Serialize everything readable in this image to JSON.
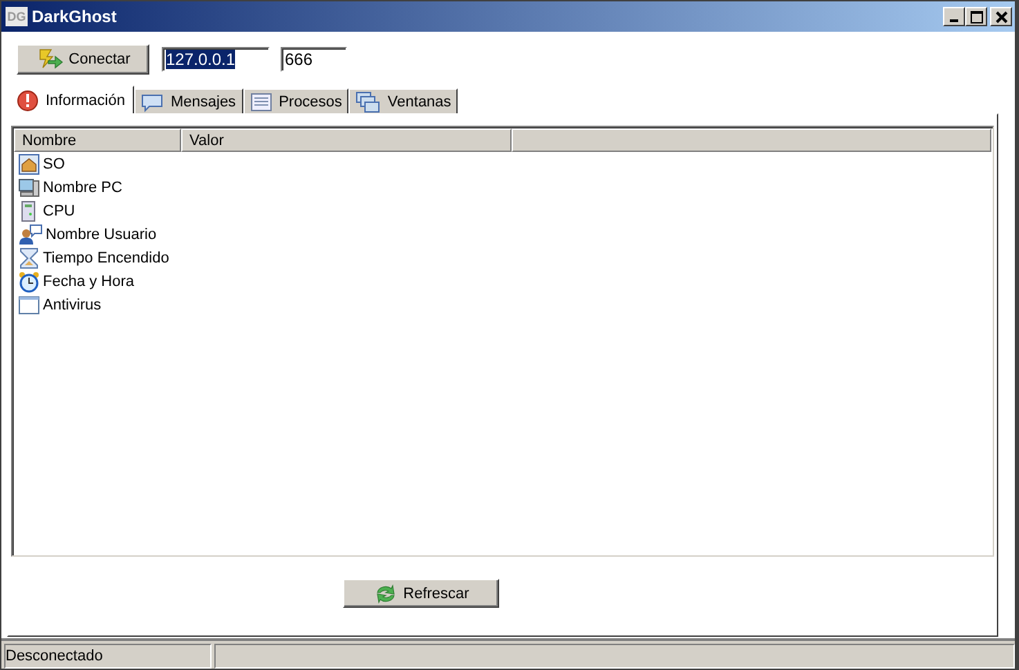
{
  "window": {
    "title": "DarkGhost",
    "icon_text": "DG"
  },
  "toolbar": {
    "connect_button": "Conectar",
    "host": "127.0.0.1",
    "host_selected": true,
    "port": "666"
  },
  "tabs": [
    {
      "label": "Información",
      "kind": "info",
      "selected": true
    },
    {
      "label": "Mensajes",
      "kind": "message",
      "selected": false
    },
    {
      "label": "Procesos",
      "kind": "list",
      "selected": false
    },
    {
      "label": "Ventanas",
      "kind": "windows",
      "selected": false
    }
  ],
  "table": {
    "columns": [
      "Nombre",
      "Valor"
    ],
    "rows": [
      {
        "name": "SO",
        "kind": "home"
      },
      {
        "name": "Nombre PC",
        "kind": "computer"
      },
      {
        "name": "CPU",
        "kind": "tower"
      },
      {
        "name": "Nombre Usuario",
        "kind": "user"
      },
      {
        "name": "Tiempo Encendido",
        "kind": "hourglass"
      },
      {
        "name": "Fecha y Hora",
        "kind": "clock"
      },
      {
        "name": "Antivirus",
        "kind": "window"
      }
    ]
  },
  "refresh_button": "Refrescar",
  "status_bar": {
    "text": "Desconectado"
  }
}
